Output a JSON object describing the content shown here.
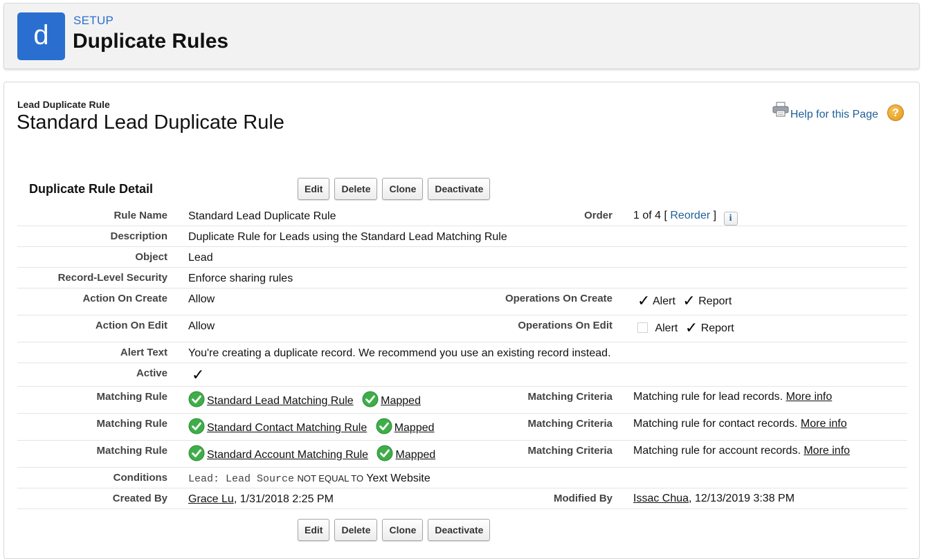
{
  "header": {
    "logo_letter": "d",
    "setup_label": "SETUP",
    "title": "Duplicate Rules"
  },
  "record": {
    "type_label": "Lead Duplicate Rule",
    "title": "Standard Lead Duplicate Rule",
    "help_link": "Help for this Page",
    "help_icon": "?"
  },
  "detail": {
    "section_title": "Duplicate Rule Detail",
    "buttons": {
      "edit": "Edit",
      "delete": "Delete",
      "clone": "Clone",
      "deactivate": "Deactivate"
    },
    "rule_name": {
      "label": "Rule Name",
      "value": "Standard Lead Duplicate Rule"
    },
    "order": {
      "label": "Order",
      "prefix": "1 of 4 [",
      "link": "Reorder",
      "suffix": "]",
      "info_icon": "i"
    },
    "description": {
      "label": "Description",
      "value": "Duplicate Rule for Leads using the Standard Lead Matching Rule"
    },
    "object": {
      "label": "Object",
      "value": "Lead"
    },
    "record_level_security": {
      "label": "Record-Level Security",
      "value": "Enforce sharing rules"
    },
    "action_on_create": {
      "label": "Action On Create",
      "value": "Allow"
    },
    "operations_on_create": {
      "label": "Operations On Create",
      "alert_label": "Alert",
      "report_label": "Report",
      "alert_checked": true,
      "report_checked": true
    },
    "action_on_edit": {
      "label": "Action On Edit",
      "value": "Allow"
    },
    "operations_on_edit": {
      "label": "Operations On Edit",
      "alert_label": "Alert",
      "report_label": "Report",
      "alert_checked": false,
      "report_checked": true
    },
    "alert_text": {
      "label": "Alert Text",
      "value": "You're creating a duplicate record. We recommend you use an existing record instead."
    },
    "active": {
      "label": "Active",
      "checked": true
    },
    "matching_rules": [
      {
        "label": "Matching Rule",
        "rule": "Standard Lead Matching Rule",
        "status": "Mapped",
        "criteria_label": "Matching Criteria",
        "criteria": "Matching rule for lead records.",
        "more": "More info"
      },
      {
        "label": "Matching Rule",
        "rule": "Standard Contact Matching Rule",
        "status": "Mapped",
        "criteria_label": "Matching Criteria",
        "criteria": "Matching rule for contact records.",
        "more": "More info"
      },
      {
        "label": "Matching Rule",
        "rule": "Standard Account Matching Rule",
        "status": "Mapped",
        "criteria_label": "Matching Criteria",
        "criteria": "Matching rule for account records.",
        "more": "More info"
      }
    ],
    "conditions": {
      "label": "Conditions",
      "field": "Lead: Lead Source",
      "operator": "NOT EQUAL TO",
      "value": "Yext Website"
    },
    "created_by": {
      "label": "Created By",
      "user": "Grace Lu",
      "date": ", 1/31/2018 2:25 PM"
    },
    "modified_by": {
      "label": "Modified By",
      "user": "Issac Chua",
      "date": ", 12/13/2019 3:38 PM"
    }
  },
  "colors": {
    "brand": "#2a6fd0",
    "link": "#1f5f99",
    "success": "#3fae49",
    "help": "#e2951b"
  }
}
